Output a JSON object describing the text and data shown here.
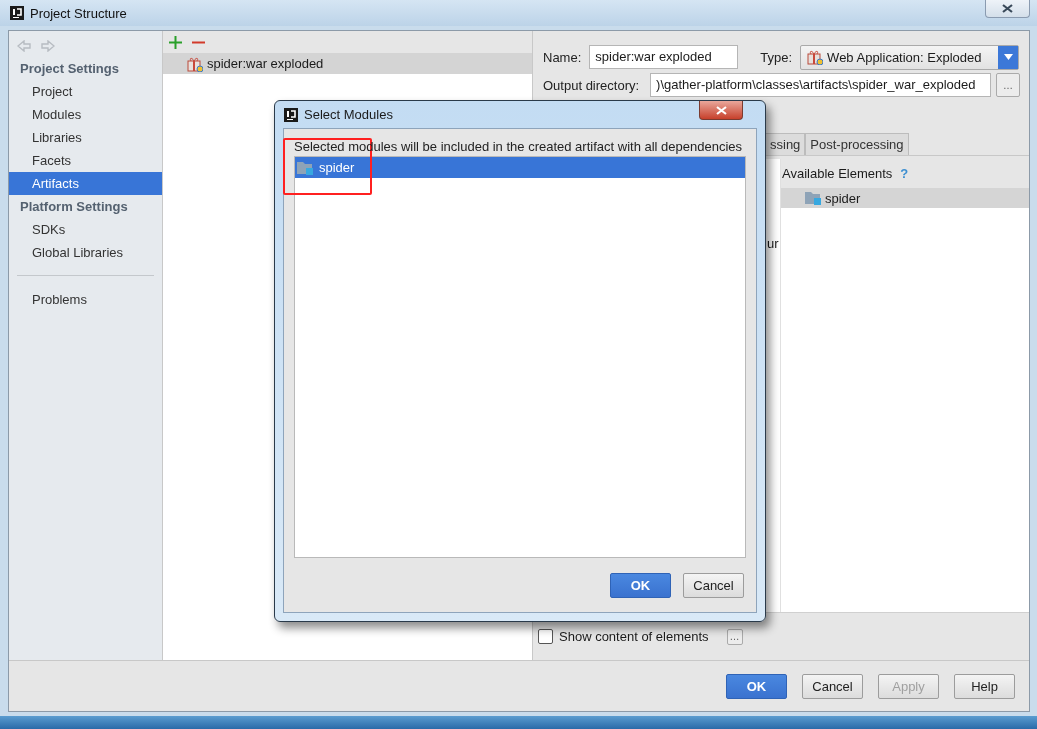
{
  "window": {
    "title": "Project Structure"
  },
  "sidebar": {
    "sections": [
      {
        "heading": "Project Settings",
        "items": [
          {
            "label": "Project",
            "selected": false
          },
          {
            "label": "Modules",
            "selected": false
          },
          {
            "label": "Libraries",
            "selected": false
          },
          {
            "label": "Facets",
            "selected": false
          },
          {
            "label": "Artifacts",
            "selected": true
          }
        ]
      },
      {
        "heading": "Platform Settings",
        "items": [
          {
            "label": "SDKs",
            "selected": false
          },
          {
            "label": "Global Libraries",
            "selected": false
          }
        ]
      }
    ],
    "footer_items": [
      {
        "label": "Problems",
        "selected": false
      }
    ]
  },
  "artifacts": {
    "items": [
      {
        "label": "spider:war exploded",
        "selected": true
      }
    ]
  },
  "details": {
    "name_label": "Name:",
    "name_value": "spider:war exploded",
    "type_label": "Type:",
    "type_value": "Web Application: Exploded",
    "output_label": "Output directory:",
    "output_value": ")\\gather-platform\\classes\\artifacts\\spider_war_exploded",
    "browse_button": "…",
    "tabs": [
      {
        "label": "ssing",
        "selected": false
      },
      {
        "label": "Post-processing",
        "selected": false
      }
    ],
    "layout_fragment": "ur",
    "available_title": "Available Elements",
    "help_mark": "?",
    "available_items": [
      {
        "label": "spider",
        "selected": true
      }
    ],
    "show_content": {
      "label": "Show content of elements",
      "checked": false
    },
    "show_content_button": "…"
  },
  "footer_buttons": [
    {
      "label": "OK",
      "kind": "primary"
    },
    {
      "label": "Cancel",
      "kind": "normal"
    },
    {
      "label": "Apply",
      "kind": "disabled"
    },
    {
      "label": "Help",
      "kind": "normal"
    }
  ],
  "dialog": {
    "title": "Select Modules",
    "description": "Selected modules will be included in the created artifact with all dependencies",
    "modules": [
      {
        "label": "spider",
        "selected": true
      }
    ],
    "buttons": [
      {
        "label": "OK",
        "kind": "primary"
      },
      {
        "label": "Cancel",
        "kind": "normal"
      }
    ]
  }
}
